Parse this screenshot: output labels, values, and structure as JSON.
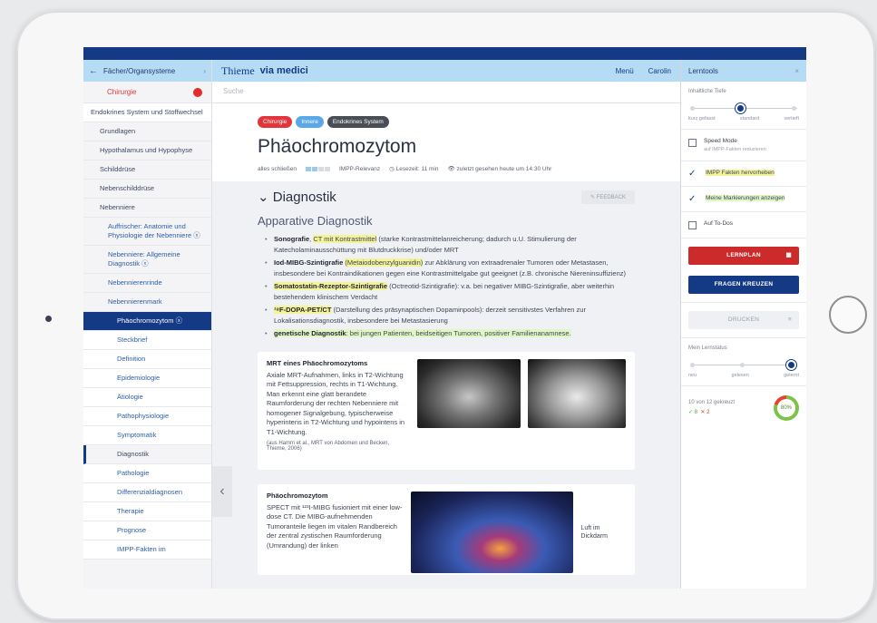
{
  "left": {
    "back_label": "Fächer/Organsysteme",
    "subject": "Chirurgie",
    "nav": [
      {
        "label": "Endokrines System und Stoffwechsel",
        "level": "top"
      },
      {
        "label": "Grundlagen",
        "level": "l1"
      },
      {
        "label": "Hypothalamus und Hypophyse",
        "level": "l1"
      },
      {
        "label": "Schilddrüse",
        "level": "l1"
      },
      {
        "label": "Nebenschilddrüse",
        "level": "l1"
      },
      {
        "label": "Nebenniere",
        "level": "l1"
      },
      {
        "label": "Auffrischer: Anatomie und Physiologie der Nebenniere ⓧ",
        "level": "l2"
      },
      {
        "label": "Nebenniere: Allgemeine Diagnostik ⓧ",
        "level": "l2"
      },
      {
        "label": "Nebennierenrinde",
        "level": "l2"
      },
      {
        "label": "Nebennierenmark",
        "level": "l2"
      },
      {
        "label": "Phäochromozytom ⓧ",
        "level": "sel"
      },
      {
        "label": "Steckbrief",
        "level": "l3"
      },
      {
        "label": "Definition",
        "level": "l3"
      },
      {
        "label": "Epidemiologie",
        "level": "l3"
      },
      {
        "label": "Ätiologie",
        "level": "l3"
      },
      {
        "label": "Pathophysiologie",
        "level": "l3"
      },
      {
        "label": "Symptomatik",
        "level": "l3"
      },
      {
        "label": "Diagnostik",
        "level": "accent"
      },
      {
        "label": "Pathologie",
        "level": "l3"
      },
      {
        "label": "Differenzialdiagnosen",
        "level": "l3"
      },
      {
        "label": "Therapie",
        "level": "l3"
      },
      {
        "label": "Prognose",
        "level": "l3"
      },
      {
        "label": "IMPP-Fakten im",
        "level": "l3"
      }
    ]
  },
  "header": {
    "logo": "Thieme",
    "logo_sub": "via medici",
    "menu": "Menü",
    "user": "Carolin",
    "search_placeholder": "Suche"
  },
  "article": {
    "tags": [
      "Chirurgie",
      "Innere",
      "Endokrines System"
    ],
    "title": "Phäochromozytom",
    "meta": {
      "close_all": "alles schließen",
      "impp": "IMPP-Relevanz",
      "read_time": "◷ Lesezeit: 11 min",
      "last_seen": "👁 zuletzt gesehen heute um 14:30 Uhr"
    },
    "section_title": "Diagnostik",
    "feedback": "FEEDBACK",
    "subtitle": "Apparative Diagnostik",
    "bullets": [
      {
        "term": "Sonografie",
        "sep": ", ",
        "hl": "CT mit Kontrastmittel",
        "rest": " (starke Kontrastmittelanreicherung; dadurch u.U. Stimulierung der Katecholaminausschüttung mit Blutdruckkrise) und/oder MRT"
      },
      {
        "term": "Iod-MIBG-Szintigrafie",
        "sep": " ",
        "hl": "(Metaiodobenzylguanidin)",
        "rest": " zur Abklärung von extraadrenaler Tumoren oder Metastasen, insbesondere bei Kontraindikationen gegen eine Kontrastmittelgabe gut geeignet (z.B. chronische Niereninsuffizienz)"
      },
      {
        "term": "Somatostatin-Rezeptor-Szintigrafie",
        "sep": " ",
        "hl": "",
        "rest": "(Octreotid-Szintigrafie): v.a. bei negativer MIBG-Szintigrafie, aber weiterhin bestehendem klinischem Verdacht"
      },
      {
        "term": "¹⁸F-DOPA-PET/CT",
        "sep": " ",
        "hl": "",
        "rest": "(Darstellung des präsynaptischen Dopaminpools): derzeit sensitivstes Verfahren zur Lokalisationsdiagnostik, insbesondere bei Metastasierung"
      },
      {
        "term": "genetische Diagnostik",
        "sep": ": ",
        "hl": "",
        "rest": "bei jungen Patienten, beidseitigen Tumoren, positiver Familienanamnese."
      }
    ],
    "figure1": {
      "title": "MRT eines Phäochromozytoms",
      "body": "Axiale MRT-Aufnahmen, links in T2-Wichtung mit Fettsuppression, rechts in T1-Wichtung. Man erkennt eine glatt berandete Raumforderung der rechten Nebenniere mit homogener Signalgebung, typischerweise hyperintens in T2-Wichtung und hypointens in T1-Wichtung.",
      "caption": "(aus Hamm et al., MRT von Abdomen und Becken, Thieme, 2006)"
    },
    "figure2": {
      "title": "Phäochromozytom",
      "body": "SPECT mit ¹²³I-MIBG fusioniert mit einer low-dose CT. Die MIBG-aufnehmenden Tumoranteile liegen im vitalen Randbereich der zentral zystischen Raumforderung (Umrandung) der linken",
      "label": "Luft im Dickdarm"
    }
  },
  "tools": {
    "title": "Lerntools",
    "depth_label": "Inhaltliche Tiefe",
    "depth_levels": [
      "kurz gefasst",
      "standard",
      "vertieft"
    ],
    "depth_selected": 1,
    "speed_mode": "Speed Mode",
    "speed_sub": "auf IMPP-Fakten reduzieren",
    "impp_highlight": "IMPP Fakten hervorheben",
    "show_marks": "Meine Markierungen anzeigen",
    "todo": "Auf To-Dos",
    "btn_lernplan": "LERNPLAN",
    "btn_fragen": "FRAGEN KREUZEN",
    "btn_drucken": "DRUCKEN",
    "status_label": "Mein Lernstatus",
    "status_levels": [
      "neu",
      "gelesen",
      "gelernt"
    ],
    "status_selected": 2,
    "progress_text": "10 von 12 gekreuzt",
    "correct": "✓ 8",
    "wrong": "✕ 2",
    "percent": "80%",
    "percent_value": 80
  },
  "colors": {
    "navy": "#143a86",
    "header_blue": "#b6dcf5",
    "red": "#cc2b2b",
    "highlight_yellow": "#f4f39a",
    "highlight_green": "#e1f6c4"
  }
}
